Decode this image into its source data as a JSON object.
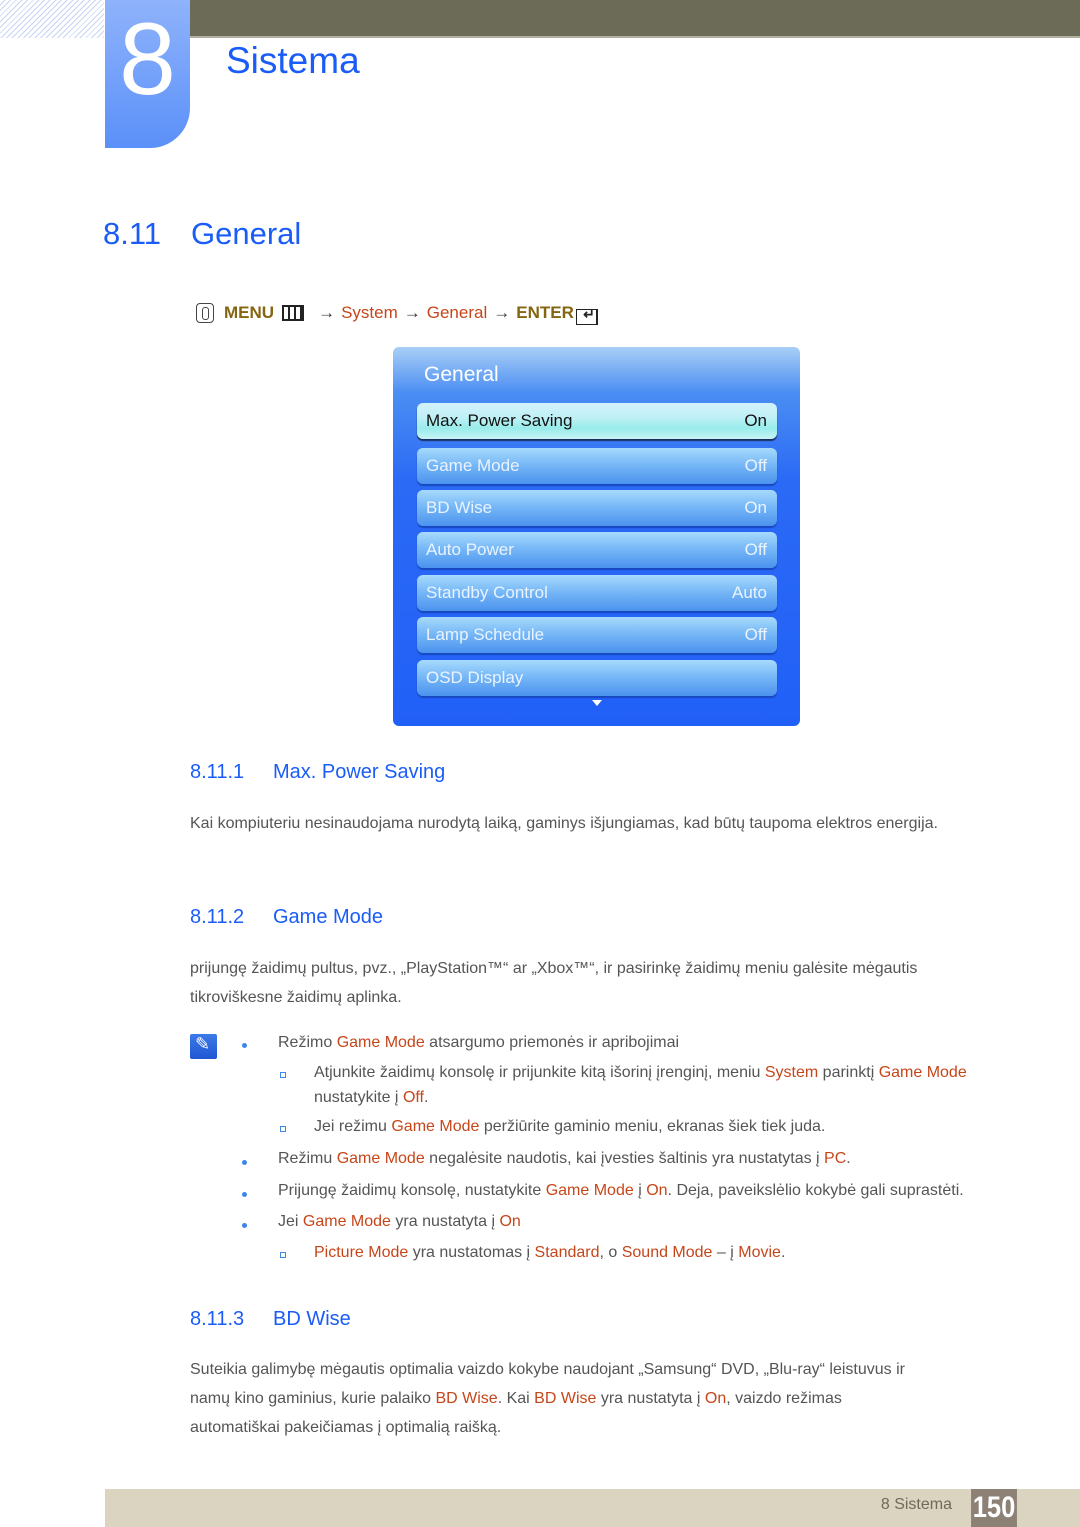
{
  "header": {
    "chapter_number": "8",
    "chapter_title": "Sistema"
  },
  "section": {
    "number": "8.11",
    "title": "General"
  },
  "menu_path": {
    "hand_icon": "remote-hand-icon",
    "menu_label": "MENU",
    "menu_icon": "menu-grid-icon",
    "arrow": "→",
    "step1": "System",
    "step2": "General",
    "enter_label": "ENTER",
    "enter_icon": "enter-icon"
  },
  "osd": {
    "title": "General",
    "items": [
      {
        "label": "Max. Power Saving",
        "value": "On",
        "selected": true
      },
      {
        "label": "Game Mode",
        "value": "Off"
      },
      {
        "label": "BD Wise",
        "value": "On"
      },
      {
        "label": "Auto Power",
        "value": "Off"
      },
      {
        "label": "Standby Control",
        "value": "Auto"
      },
      {
        "label": "Lamp Schedule",
        "value": "Off"
      },
      {
        "label": "OSD Display",
        "value": ""
      }
    ],
    "more_indicator": "down-arrow-icon"
  },
  "sub1": {
    "number": "8.11.1",
    "title": "Max. Power Saving",
    "text": "Kai kompiuteriu nesinaudojama nurodytą laiką, gaminys išjungiamas, kad būtų taupoma elektros energija."
  },
  "sub2": {
    "number": "8.11.2",
    "title": "Game Mode",
    "text": "prijungę žaidimų pultus, pvz., „PlayStation™“ ar „Xbox™“, ir pasirinkę žaidimų meniu galėsite mėgautis tikroviškesne žaidimų aplinka.",
    "notes": {
      "b1": {
        "pre": "Režimo ",
        "hl": "Game Mode",
        "post": " atsargumo priemonės ir apribojimai"
      },
      "s1": {
        "a": "Atjunkite žaidimų konsolę ir prijunkite kitą išorinį įrenginį, meniu ",
        "h1": "System",
        "b": " parinktį ",
        "h2": "Game Mode",
        "c": "nustatykite į ",
        "h3": "Off",
        "d": "."
      },
      "s2": {
        "a": "Jei režimu ",
        "h1": "Game Mode",
        "b": " peržiūrite gaminio meniu, ekranas šiek tiek juda."
      },
      "b2": {
        "a": "Režimu ",
        "h1": "Game Mode",
        "b": " negalėsite naudotis, kai įvesties šaltinis yra nustatytas į ",
        "h2": "PC",
        "c": "."
      },
      "b3": {
        "a": "Prijungę žaidimų konsolę, nustatykite ",
        "h1": "Game Mode",
        "b": " į ",
        "h2": "On",
        "c": ". Deja, paveikslėlio kokybė gali suprastėti."
      },
      "b4": {
        "a": "Jei ",
        "h1": "Game Mode",
        "b": " yra nustatyta į ",
        "h2": "On"
      },
      "s3": {
        "h1": "Picture Mode",
        "a": " yra nustatomas į ",
        "h2": "Standard",
        "b": ", o ",
        "h3": "Sound Mode",
        "c": " – į ",
        "h4": "Movie",
        "d": "."
      }
    }
  },
  "sub3": {
    "number": "8.11.3",
    "title": "BD Wise",
    "p1": "Suteikia galimybę mėgautis optimalia vaizdo kokybe naudojant „Samsung“ DVD, „Blu-ray“ leistuvus ir",
    "p2a": "namų kino gaminius, kurie palaiko ",
    "p2h1": "BD Wise",
    "p2b": ". Kai ",
    "p2h2": "BD Wise",
    "p2c": " yra nustatyta į ",
    "p2h3": "On",
    "p2d": ", vaizdo režimas",
    "p3": "automatiškai pakeičiamas į optimalią raišką."
  },
  "footer": {
    "label": "8 Sistema",
    "page": "150"
  },
  "colors": {
    "heading_blue": "#1a5cf7",
    "highlight": "#c6461a",
    "menu_gold": "#85650f",
    "topbar": "#6c6b57",
    "footer_bg": "#dad4c0",
    "page_box": "#8d8175"
  }
}
